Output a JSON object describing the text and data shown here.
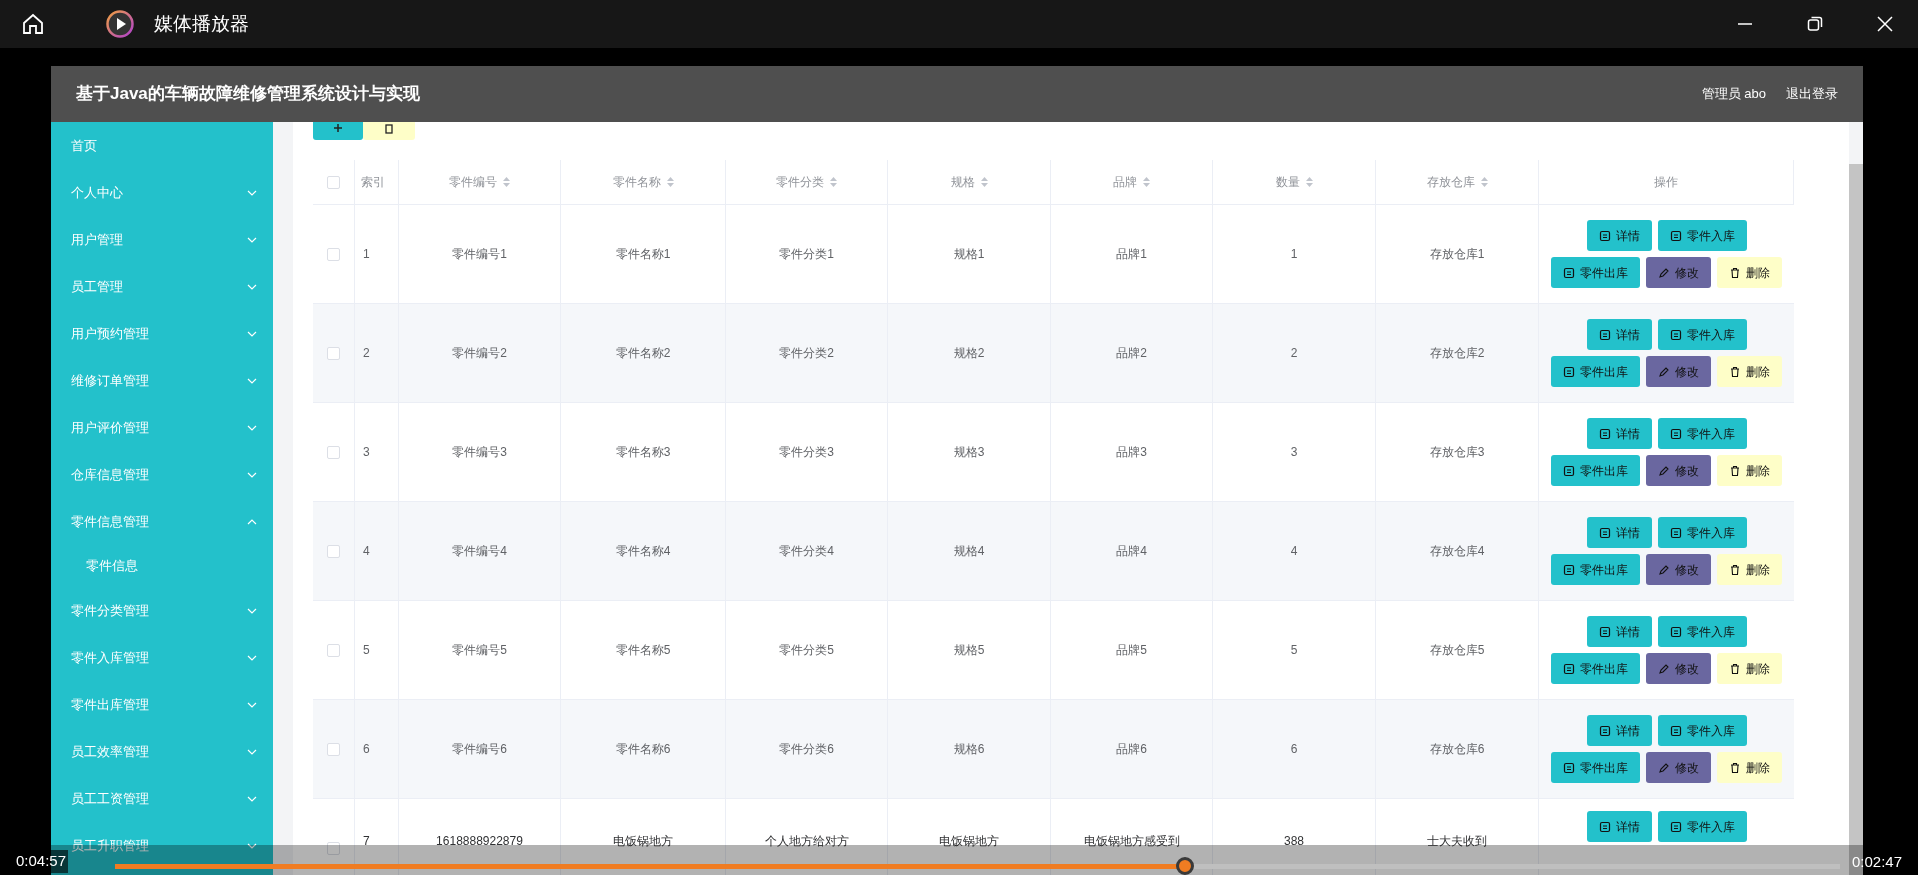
{
  "player": {
    "title": "媒体播放器",
    "elapsed": "0:04:57",
    "remaining": "0:02:47",
    "level": 0.62
  },
  "app": {
    "title": "基于Java的车辆故障维修管理系统设计与实现",
    "user": "管理员 abo",
    "logout": "退出登录"
  },
  "sidebar": [
    {
      "label": "首页"
    },
    {
      "label": "个人中心",
      "expanded": false
    },
    {
      "label": "用户管理",
      "expanded": false
    },
    {
      "label": "员工管理",
      "expanded": false
    },
    {
      "label": "用户预约管理",
      "expanded": false
    },
    {
      "label": "维修订单管理",
      "expanded": false
    },
    {
      "label": "用户评价管理",
      "expanded": false
    },
    {
      "label": "仓库信息管理",
      "expanded": false
    },
    {
      "label": "零件信息管理",
      "expanded": true,
      "children": [
        {
          "label": "零件信息"
        }
      ]
    },
    {
      "label": "零件分类管理",
      "expanded": false
    },
    {
      "label": "零件入库管理",
      "expanded": false
    },
    {
      "label": "零件出库管理",
      "expanded": false
    },
    {
      "label": "员工效率管理",
      "expanded": false
    },
    {
      "label": "员工工资管理",
      "expanded": false
    },
    {
      "label": "员工升职管理",
      "expanded": false
    }
  ],
  "toolbar": [
    {
      "kind": "add"
    },
    {
      "kind": "delete"
    }
  ],
  "table": {
    "header_checked": false,
    "columns": [
      {
        "label": "索引",
        "sortable": false
      },
      {
        "label": "零件编号",
        "sortable": true
      },
      {
        "label": "零件名称",
        "sortable": true
      },
      {
        "label": "零件分类",
        "sortable": true
      },
      {
        "label": "规格",
        "sortable": true
      },
      {
        "label": "品牌",
        "sortable": true
      },
      {
        "label": "数量",
        "sortable": true
      },
      {
        "label": "存放仓库",
        "sortable": true
      },
      {
        "label": "操作",
        "sortable": false
      }
    ],
    "rows": [
      {
        "checked": false,
        "cells": [
          "1",
          "零件编号1",
          "零件名称1",
          "零件分类1",
          "规格1",
          "品牌1",
          "1",
          "存放仓库1"
        ],
        "actions": [
          {
            "kind": "detail",
            "label": "详情"
          },
          {
            "kind": "in",
            "label": "零件入库"
          },
          {
            "kind": "out",
            "label": "零件出库"
          },
          {
            "kind": "edit",
            "label": "修改"
          },
          {
            "kind": "delete",
            "label": "删除"
          }
        ]
      },
      {
        "checked": false,
        "cells": [
          "2",
          "零件编号2",
          "零件名称2",
          "零件分类2",
          "规格2",
          "品牌2",
          "2",
          "存放仓库2"
        ],
        "actions": [
          {
            "kind": "detail",
            "label": "详情"
          },
          {
            "kind": "in",
            "label": "零件入库"
          },
          {
            "kind": "out",
            "label": "零件出库"
          },
          {
            "kind": "edit",
            "label": "修改"
          },
          {
            "kind": "delete",
            "label": "删除"
          }
        ]
      },
      {
        "checked": false,
        "cells": [
          "3",
          "零件编号3",
          "零件名称3",
          "零件分类3",
          "规格3",
          "品牌3",
          "3",
          "存放仓库3"
        ],
        "actions": [
          {
            "kind": "detail",
            "label": "详情"
          },
          {
            "kind": "in",
            "label": "零件入库"
          },
          {
            "kind": "out",
            "label": "零件出库"
          },
          {
            "kind": "edit",
            "label": "修改"
          },
          {
            "kind": "delete",
            "label": "删除"
          }
        ]
      },
      {
        "checked": false,
        "cells": [
          "4",
          "零件编号4",
          "零件名称4",
          "零件分类4",
          "规格4",
          "品牌4",
          "4",
          "存放仓库4"
        ],
        "actions": [
          {
            "kind": "detail",
            "label": "详情"
          },
          {
            "kind": "in",
            "label": "零件入库"
          },
          {
            "kind": "out",
            "label": "零件出库"
          },
          {
            "kind": "edit",
            "label": "修改"
          },
          {
            "kind": "delete",
            "label": "删除"
          }
        ]
      },
      {
        "checked": false,
        "cells": [
          "5",
          "零件编号5",
          "零件名称5",
          "零件分类5",
          "规格5",
          "品牌5",
          "5",
          "存放仓库5"
        ],
        "actions": [
          {
            "kind": "detail",
            "label": "详情"
          },
          {
            "kind": "in",
            "label": "零件入库"
          },
          {
            "kind": "out",
            "label": "零件出库"
          },
          {
            "kind": "edit",
            "label": "修改"
          },
          {
            "kind": "delete",
            "label": "删除"
          }
        ]
      },
      {
        "checked": false,
        "cells": [
          "6",
          "零件编号6",
          "零件名称6",
          "零件分类6",
          "规格6",
          "品牌6",
          "6",
          "存放仓库6"
        ],
        "actions": [
          {
            "kind": "detail",
            "label": "详情"
          },
          {
            "kind": "in",
            "label": "零件入库"
          },
          {
            "kind": "out",
            "label": "零件出库"
          },
          {
            "kind": "edit",
            "label": "修改"
          },
          {
            "kind": "delete",
            "label": "删除"
          }
        ]
      },
      {
        "checked": false,
        "cells": [
          "7",
          "1618888922879",
          "电饭锅地方",
          "个人地方给对方",
          "电饭锅地方",
          "电饭锅地方感受到",
          "388",
          "士大夫收到"
        ],
        "actions": [
          {
            "kind": "detail",
            "label": "详情"
          },
          {
            "kind": "in",
            "label": "零件入库"
          }
        ]
      }
    ]
  }
}
